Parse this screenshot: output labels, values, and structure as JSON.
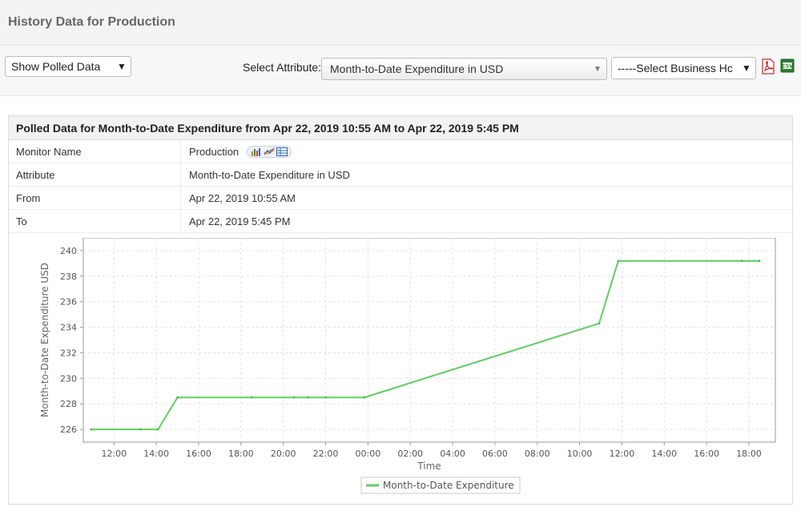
{
  "page": {
    "title": "History Data for Production"
  },
  "controls": {
    "view_select": "Show Polled Data",
    "attribute_label": "Select Attribute:",
    "attribute_select": "Month-to-Date Expenditure in USD",
    "business_hours_select": "-----Select Business Hc"
  },
  "panel": {
    "heading": "Polled Data for Month-to-Date Expenditure from Apr 22, 2019 10:55 AM to Apr 22, 2019 5:45 PM",
    "rows": [
      {
        "key": "Monitor Name",
        "value": "Production"
      },
      {
        "key": "Attribute",
        "value": "Month-to-Date Expenditure in USD"
      },
      {
        "key": "From",
        "value": "Apr 22, 2019 10:55 AM"
      },
      {
        "key": "To",
        "value": "Apr 22, 2019 5:45 PM"
      }
    ]
  },
  "colors": {
    "series": "#5fcf5f",
    "grid": "#e3e3e3",
    "axis": "#9a9a9a"
  },
  "chart_data": {
    "type": "line",
    "xlabel": "Time",
    "ylabel": "Month-to-Date Expenditure USD",
    "ylim": [
      225,
      241
    ],
    "yticks": [
      226,
      228,
      230,
      232,
      234,
      236,
      238,
      240
    ],
    "xlim_hours": [
      10.55,
      18.75
    ],
    "xticks": [
      "12:00",
      "14:00",
      "16:00",
      "18:00",
      "20:00",
      "22:00",
      "00:00",
      "02:00",
      "04:00",
      "06:00",
      "08:00",
      "10:00",
      "12:00",
      "14:00",
      "16:00",
      "18:00"
    ],
    "grid": true,
    "legend_position": "bottom",
    "series": [
      {
        "name": "Month-to-Date Expenditure",
        "x": [
          "10:55",
          "13:15",
          "14:05",
          "15:00",
          "18:30",
          "20:30",
          "21:10",
          "22:00",
          "23:50",
          "10:55",
          "11:50",
          "17:40",
          "18:45"
        ],
        "x_hours": [
          10.92,
          13.25,
          14.08,
          15.0,
          18.5,
          20.5,
          21.17,
          22.0,
          23.83,
          34.92,
          35.83,
          41.67,
          42.5
        ],
        "y": [
          226.0,
          226.0,
          226.0,
          228.5,
          228.5,
          228.5,
          228.5,
          228.5,
          228.5,
          234.3,
          239.2,
          239.2,
          239.2
        ]
      }
    ]
  }
}
